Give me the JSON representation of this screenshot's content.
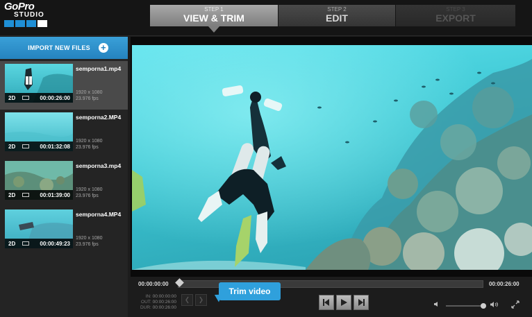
{
  "header": {
    "logo_text": "GoPro",
    "logo_sub": "STUDIO",
    "logo_colors": [
      "#1f8fd6",
      "#1f8fd6",
      "#1f8fd6",
      "#ffffff"
    ],
    "steps": [
      {
        "small": "STEP 1",
        "big": "VIEW & TRIM",
        "state": "active"
      },
      {
        "small": "STEP 2",
        "big": "EDIT",
        "state": "inactive"
      },
      {
        "small": "STEP 3",
        "big": "EXPORT",
        "state": "disabled"
      }
    ]
  },
  "sidebar": {
    "import_label": "IMPORT NEW FILES",
    "files": [
      {
        "name": "semporna1.mp4",
        "duration": "00:00:26:00",
        "mode": "2D",
        "resolution": "1920 x 1080",
        "fps": "23.976 fps",
        "selected": true
      },
      {
        "name": "semporna2.MP4",
        "duration": "00:01:32:08",
        "mode": "2D",
        "resolution": "1920 x 1080",
        "fps": "23.976 fps",
        "selected": false
      },
      {
        "name": "semporna3.mp4",
        "duration": "00:01:39:00",
        "mode": "2D",
        "resolution": "1920 x 1080",
        "fps": "23.976 fps",
        "selected": false
      },
      {
        "name": "semporna4.MP4",
        "duration": "00:00:49:23",
        "mode": "2D",
        "resolution": "1920 x 1080",
        "fps": "23.976 fps",
        "selected": false
      }
    ]
  },
  "player": {
    "time_start": "00:00:00:00",
    "time_end": "00:00:26:00",
    "in_label": "IN:",
    "in_value": "00:00:00:00",
    "out_label": "OUT:",
    "out_value": "00:00:26:00",
    "dur_label": "DUR:",
    "dur_value": "00:00:26:00",
    "tooltip": "Trim video",
    "volume_level": 0.9
  },
  "colors": {
    "accent": "#2fa0dc",
    "water": "#3cc6d2"
  }
}
